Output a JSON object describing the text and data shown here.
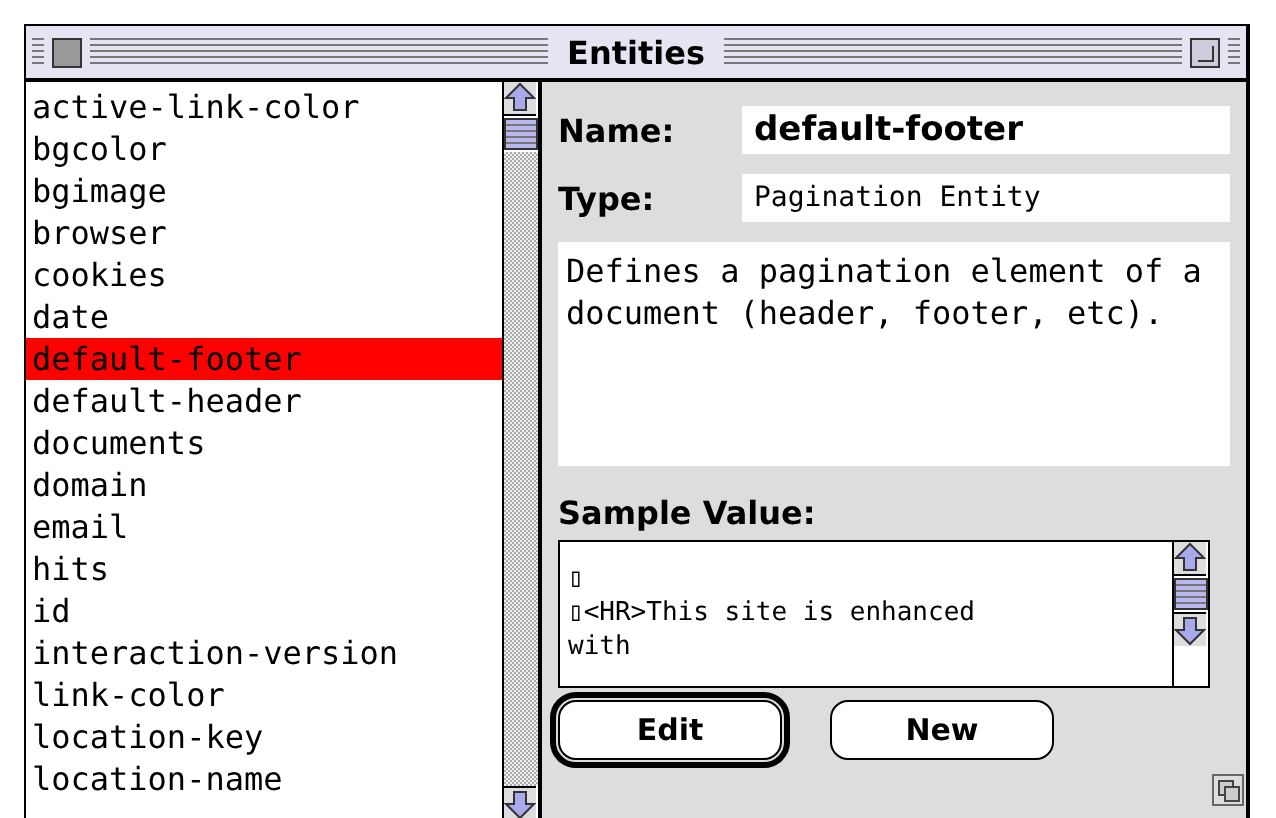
{
  "window": {
    "title": "Entities"
  },
  "entities": [
    {
      "label": "active-link-color",
      "selected": false
    },
    {
      "label": "bgcolor",
      "selected": false
    },
    {
      "label": "bgimage",
      "selected": false
    },
    {
      "label": "browser",
      "selected": false
    },
    {
      "label": "cookies",
      "selected": false
    },
    {
      "label": "date",
      "selected": false
    },
    {
      "label": "default-footer",
      "selected": true
    },
    {
      "label": "default-header",
      "selected": false
    },
    {
      "label": "documents",
      "selected": false
    },
    {
      "label": "domain",
      "selected": false
    },
    {
      "label": "email",
      "selected": false
    },
    {
      "label": "hits",
      "selected": false
    },
    {
      "label": "id",
      "selected": false
    },
    {
      "label": "interaction-version",
      "selected": false
    },
    {
      "label": "link-color",
      "selected": false
    },
    {
      "label": "location-key",
      "selected": false
    },
    {
      "label": "location-name",
      "selected": false
    }
  ],
  "details": {
    "name_label": "Name:",
    "name": "default-footer",
    "type_label": "Type:",
    "type": "Pagination Entity",
    "description": "Defines a pagination element of a document (header, footer, etc).",
    "sample_label": "Sample Value:",
    "sample_lines": [
      "▯",
      "▯<HR>This site is enhanced",
      "with"
    ]
  },
  "buttons": [
    {
      "label": "Edit",
      "default": true
    },
    {
      "label": "New",
      "default": false
    }
  ]
}
